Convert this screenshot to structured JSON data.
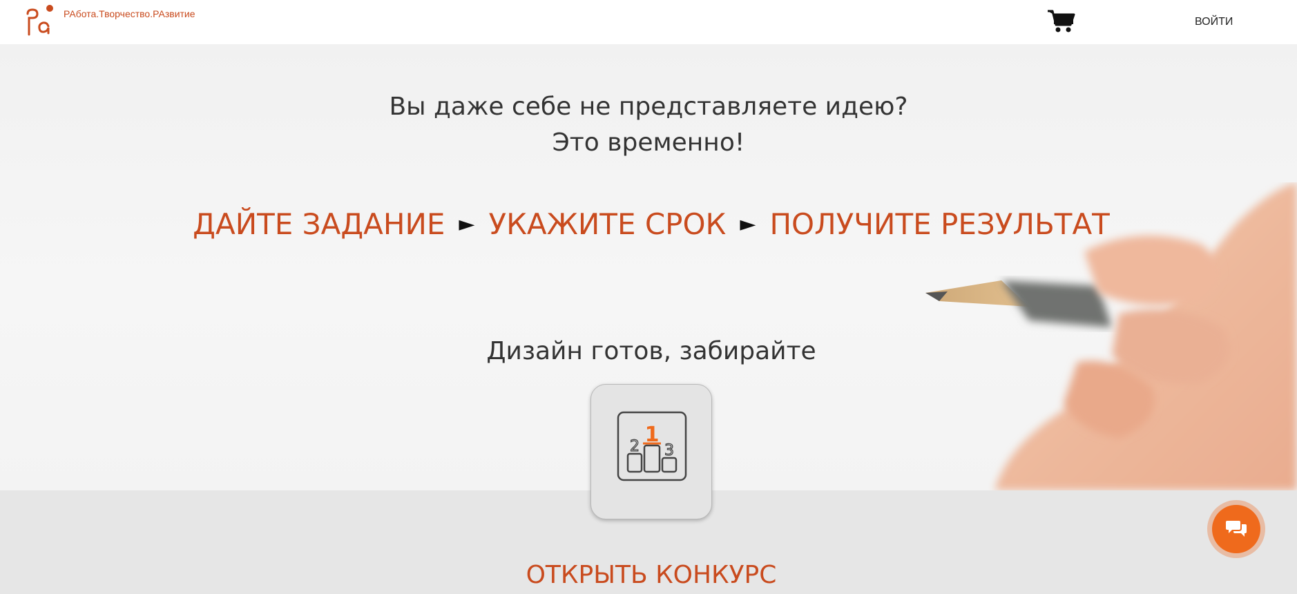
{
  "header": {
    "tagline": "РАбота.Творчество.РАзвитие",
    "login_label": "ВОЙТИ",
    "logo_icon": "ptr-logo-icon",
    "cart_icon": "cart-icon"
  },
  "hero": {
    "line1": "Вы даже себе не представляете идею?",
    "line2": "Это временно!",
    "steps": [
      {
        "label": "ДАЙТЕ ЗАДАНИЕ"
      },
      {
        "label": "УКАЖИТЕ СРОК"
      },
      {
        "label": "ПОЛУЧИТЕ РЕЗУЛЬТАТ"
      }
    ],
    "step_arrow": "►",
    "design_ready": "Дизайн готов, забирайте",
    "podium_icon": "podium-icon",
    "podium_places": [
      "1",
      "2",
      "3"
    ]
  },
  "cta": {
    "open_contest_label": "ОТКРЫТЬ КОНКУРС"
  },
  "chat": {
    "icon": "chat-icon"
  },
  "colors": {
    "accent": "#c94b1e",
    "chat_button": "#ef6a1c",
    "hero_bg": "#f3f3f3",
    "bottom_bg": "#e6e6e6"
  }
}
